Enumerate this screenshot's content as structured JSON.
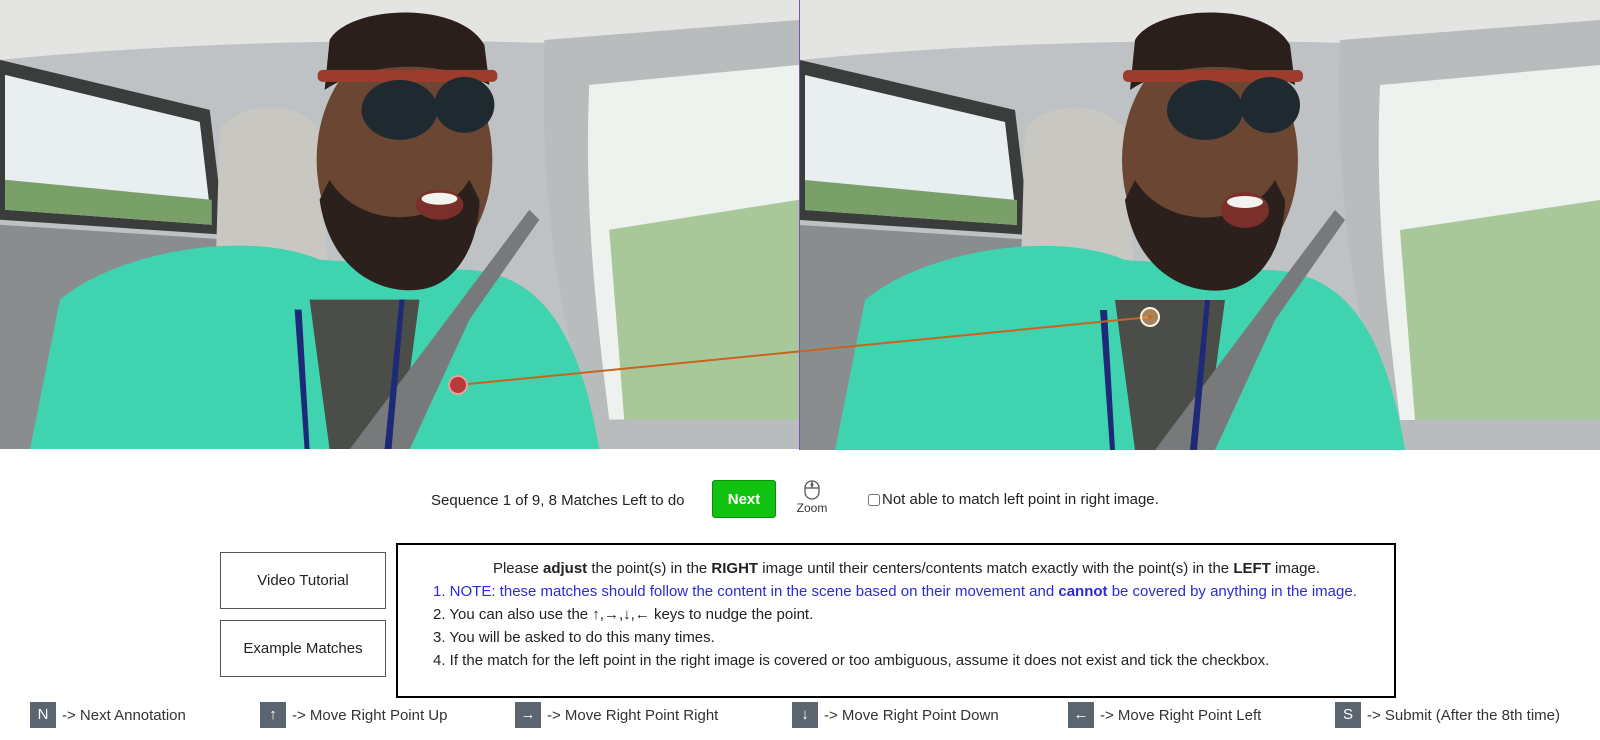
{
  "controls": {
    "sequence_text": "Sequence 1 of 9, 8 Matches Left to do",
    "next_label": "Next",
    "zoom_label": "Zoom",
    "checkbox_label": "Not able to match left point in right image.",
    "checkbox_checked": false
  },
  "side_buttons": {
    "video_tutorial": "Video Tutorial",
    "example_matches": "Example Matches"
  },
  "instructions": {
    "head": [
      {
        "t": "Please ",
        "b": false
      },
      {
        "t": "adjust",
        "b": true
      },
      {
        "t": " the point(s) in the ",
        "b": false
      },
      {
        "t": "RIGHT",
        "b": true
      },
      {
        "t": " image until their centers/contents match exactly with the point(s) in the ",
        "b": false
      },
      {
        "t": "LEFT",
        "b": true
      },
      {
        "t": " image.",
        "b": false
      }
    ],
    "item1": [
      {
        "t": "1. NOTE: these matches should follow the content in the scene based on their movement and ",
        "b": false
      },
      {
        "t": "cannot",
        "b": true
      },
      {
        "t": " be covered by anything in the image.",
        "b": false
      }
    ],
    "item2": "2. You can also use the ↑,→,↓,← keys to nudge the point.",
    "item3": "3. You will be asked to do this many times.",
    "item4": "4. If the match for the left point in the right image is covered or too ambiguous, assume it does not exist and tick the checkbox."
  },
  "shortcuts": [
    {
      "key": "N",
      "label": "-> Next Annotation"
    },
    {
      "key": "↑",
      "label": "-> Move Right Point Up"
    },
    {
      "key": "→",
      "label": "-> Move Right Point Right"
    },
    {
      "key": "↓",
      "label": "-> Move Right Point Down"
    },
    {
      "key": "←",
      "label": "-> Move Right Point Left"
    },
    {
      "key": "S",
      "label": "-> Submit (After the 8th time)"
    }
  ],
  "colors": {
    "next_button": "#11c211",
    "divider": "#7d4fc0",
    "match_line": "#c8641e",
    "left_point": "#b83a3a",
    "right_point": "#f0b070",
    "note_text": "#2b2bd6",
    "key_bg": "#5b6570"
  }
}
